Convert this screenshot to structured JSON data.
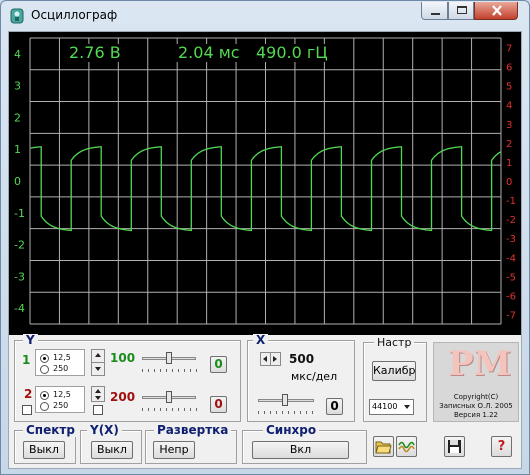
{
  "window": {
    "title": "Осциллограф"
  },
  "readouts": {
    "voltage": "2.76 В",
    "time": "2.04 мс",
    "freq": "490.0 гЦ"
  },
  "axes": {
    "left_ticks": [
      "4",
      "3",
      "2",
      "1",
      "0",
      "-1",
      "-2",
      "-3",
      "-4"
    ],
    "right_ticks": [
      "7",
      "6",
      "5",
      "4",
      "3",
      "2",
      "1",
      "0",
      "-1",
      "-2",
      "-3",
      "-4",
      "-5",
      "-6",
      "-7"
    ],
    "left_color": "#52d952",
    "right_color": "#e03030",
    "grid_color": "#b0b0b0"
  },
  "trace": {
    "color": "#52d952",
    "period_divisions": 2.04,
    "high_level": 1.1,
    "low_level": -1.6,
    "droop": 0.45
  },
  "y_panel": {
    "legend": "Y",
    "ch1": {
      "label": "1",
      "opt_a": "12,5",
      "opt_b": "250",
      "gain": "100",
      "offset": "0",
      "color": "#1a8c1a"
    },
    "ch2": {
      "label": "2",
      "opt_a": "12,5",
      "opt_b": "250",
      "gain": "200",
      "offset": "0",
      "color": "#a01010"
    }
  },
  "x_panel": {
    "legend": "X",
    "value": "500",
    "unit": "мкс/дел",
    "offset": "0"
  },
  "settings_panel": {
    "legend": "Настр",
    "calib_button": "Калибр",
    "rate": "44100"
  },
  "logo": {
    "mark": "PM",
    "line1": "Copyright(C)",
    "line2": "Записных О.Л. 2005",
    "line3": "Версия 1.22"
  },
  "bottom": {
    "spectrum": {
      "legend": "Спектр",
      "button": "Выкл"
    },
    "yx": {
      "legend": "Y(X)",
      "button": "Выкл"
    },
    "sweep": {
      "legend": "Развертка",
      "button": "Непр"
    },
    "sync": {
      "legend": "Синхро",
      "button": "Вкл"
    },
    "help_button": "?"
  },
  "icons": [
    "open-folder-icon",
    "waveform-icon",
    "save-disk-icon"
  ]
}
